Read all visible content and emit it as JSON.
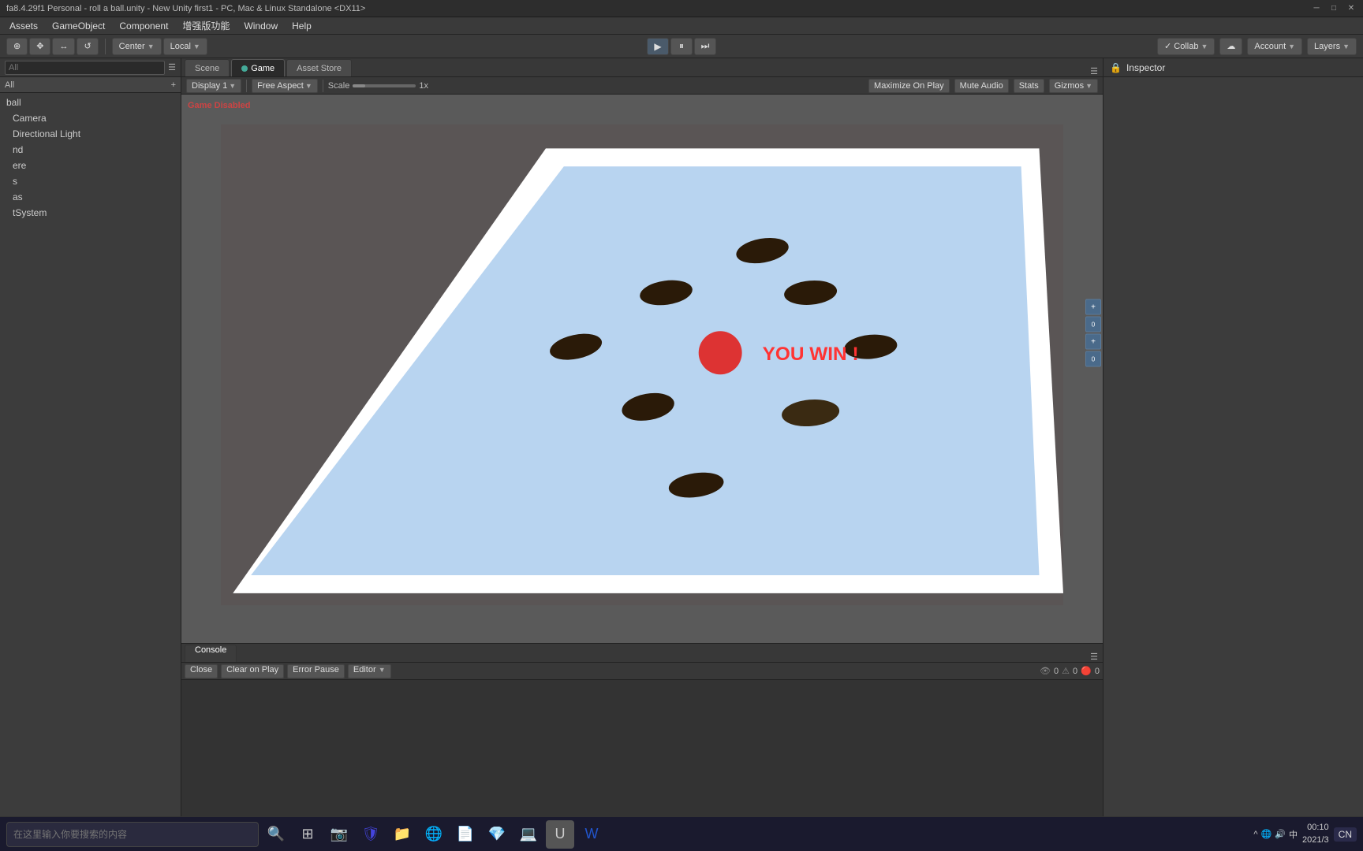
{
  "titleBar": {
    "title": "fa8.4.29f1 Personal - roll a ball.unity - New Unity first1 - PC, Mac & Linux Standalone <DX11>",
    "minimize": "─",
    "maximize": "□",
    "close": "✕"
  },
  "menuBar": {
    "items": [
      "Assets",
      "GameObject",
      "Component",
      "增强版功能",
      "Window",
      "Help"
    ]
  },
  "toolbar": {
    "transformButtons": [
      "⊕",
      "✥",
      "↔",
      "↻"
    ],
    "centerLocal": [
      "Center",
      "Local"
    ],
    "collab": "Collab",
    "cloudBtn": "☁",
    "account": "Account",
    "layers": "Layers"
  },
  "viewTabs": {
    "tabs": [
      "Scene",
      "Game",
      "Asset Store"
    ],
    "active": "Game"
  },
  "gameToolbar": {
    "displayLabel": "Display 1",
    "aspectLabel": "Free Aspect",
    "scaleLabel": "Scale",
    "scaleValue": "1x",
    "maximizeOnPlay": "Maximize On Play",
    "muteAudio": "Mute Audio",
    "stats": "Stats",
    "gizmos": "Gizmos"
  },
  "hierarchyPanel": {
    "searchPlaceholder": "All",
    "items": [
      {
        "name": "all",
        "label": "All",
        "indent": 0
      },
      {
        "name": "ball",
        "label": "ball",
        "indent": 0
      },
      {
        "name": "camera",
        "label": "Camera",
        "indent": 1
      },
      {
        "name": "directionalLight",
        "label": "Directional Light",
        "indent": 1
      },
      {
        "name": "ground",
        "label": "nd",
        "indent": 1
      },
      {
        "name": "sphere",
        "label": "ere",
        "indent": 1
      },
      {
        "name": "pickups",
        "label": "s",
        "indent": 1
      },
      {
        "name": "canvas",
        "label": "as",
        "indent": 1
      },
      {
        "name": "eventSystem",
        "label": "tSystem",
        "indent": 1
      }
    ]
  },
  "inspectorPanel": {
    "title": "Inspector",
    "lockIcon": "🔒"
  },
  "gameScene": {
    "disabledLabel": "Game Disabled",
    "youWinText": "YOU WIN !",
    "boardColor": "#b8cfe8",
    "boardBorderColor": "#f0f0f0",
    "ballColor": "#dd3333",
    "pickupColor": "#2a1a0a"
  },
  "consolPanel": {
    "tabLabel": "Console",
    "clearOnPlay": "Clear on Play",
    "errorPause": "Error Pause",
    "editor": "Editor",
    "errorCount": "0",
    "warningCount": "0",
    "infoCount": "0"
  },
  "taskbar": {
    "searchPlaceholder": "在这里输入你要搜索的内容",
    "clock": "00:10",
    "date": "2021/3",
    "language": "CN",
    "trayItems": [
      "🔊",
      "🌐",
      "中"
    ]
  }
}
